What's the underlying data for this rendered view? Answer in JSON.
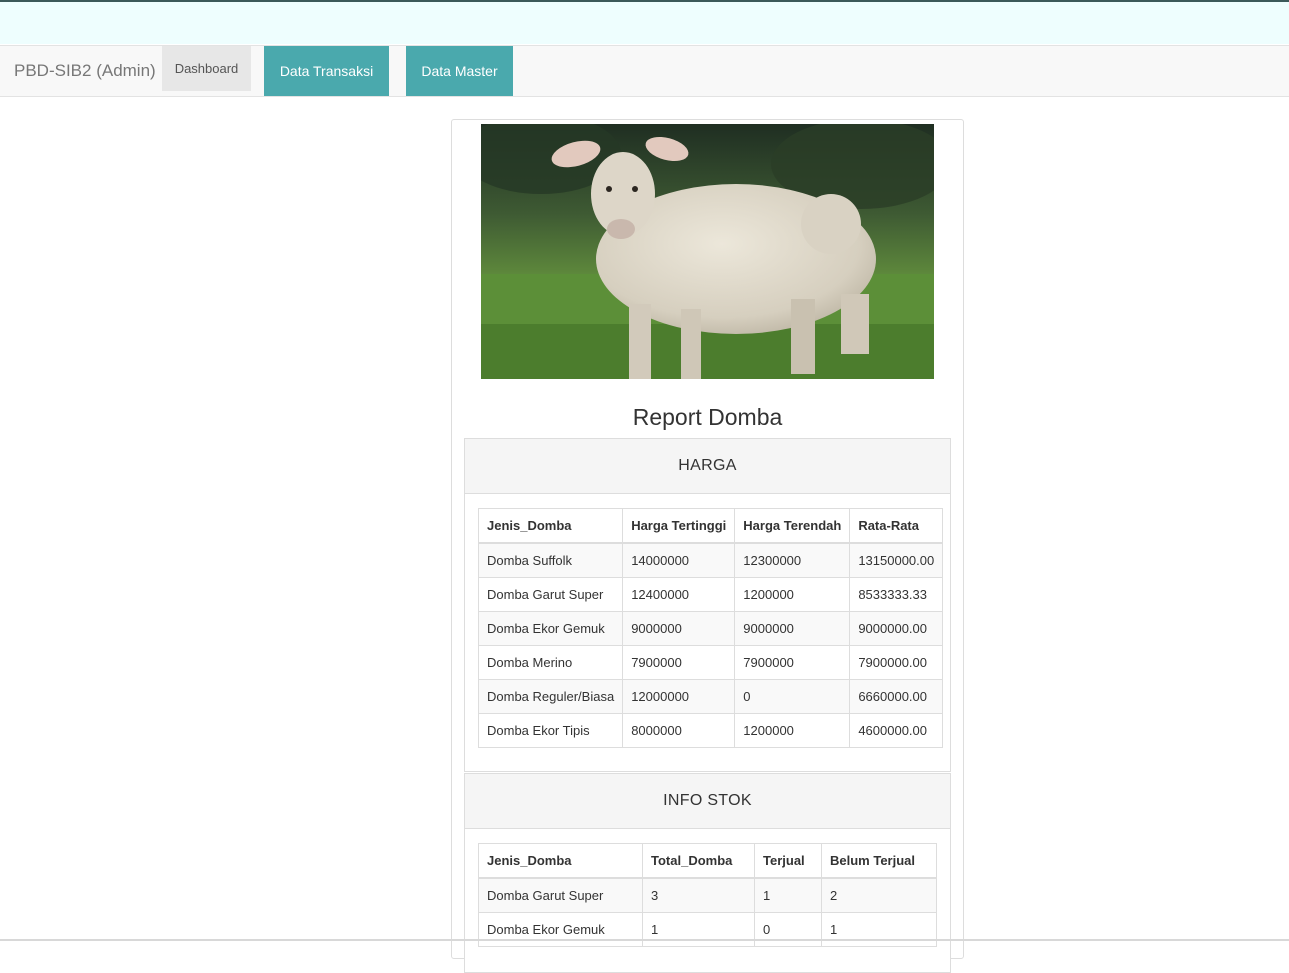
{
  "navbar": {
    "brand": "PBD-SIB2 (Admin)",
    "dashboard": "Dashboard",
    "data_transaksi": "Data Transaksi",
    "data_master": "Data Master",
    "accent_color": "#4aa9ad"
  },
  "report": {
    "title": "Report Domba",
    "image": "sheep-photo"
  },
  "harga": {
    "heading": "HARGA",
    "columns": [
      "Jenis_Domba",
      "Harga Tertinggi",
      "Harga Terendah",
      "Rata-Rata"
    ],
    "rows": [
      [
        "Domba Suffolk",
        "14000000",
        "12300000",
        "13150000.00"
      ],
      [
        "Domba Garut Super",
        "12400000",
        "1200000",
        "8533333.33"
      ],
      [
        "Domba Ekor Gemuk",
        "9000000",
        "9000000",
        "9000000.00"
      ],
      [
        "Domba Merino",
        "7900000",
        "7900000",
        "7900000.00"
      ],
      [
        "Domba Reguler/Biasa",
        "12000000",
        "0",
        "6660000.00"
      ],
      [
        "Domba Ekor Tipis",
        "8000000",
        "1200000",
        "4600000.00"
      ]
    ]
  },
  "stok": {
    "heading": "INFO STOK",
    "columns": [
      "Jenis_Domba",
      "Total_Domba",
      "Terjual",
      "Belum Terjual"
    ],
    "rows": [
      [
        "Domba Garut Super",
        "3",
        "1",
        "2"
      ],
      [
        "Domba Ekor Gemuk",
        "1",
        "0",
        "1"
      ]
    ]
  }
}
